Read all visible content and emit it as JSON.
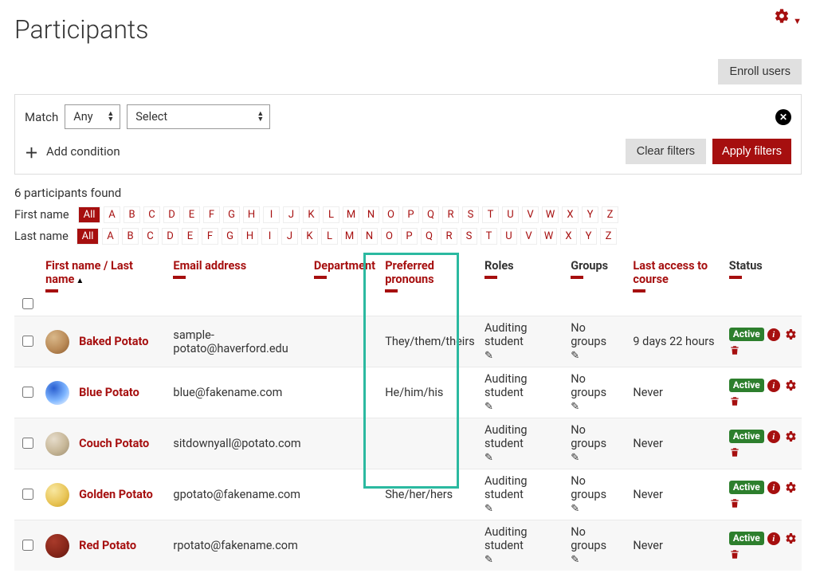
{
  "page_title": "Participants",
  "enroll_button": "Enroll users",
  "filter": {
    "match_label": "Match",
    "match_value": "Any",
    "select_value": "Select",
    "add_condition": "Add condition",
    "clear_filters": "Clear filters",
    "apply_filters": "Apply filters"
  },
  "count_text": "6 participants found",
  "initials": {
    "firstname_label": "First name",
    "lastname_label": "Last name",
    "all_label": "All",
    "letters": [
      "A",
      "B",
      "C",
      "D",
      "E",
      "F",
      "G",
      "H",
      "I",
      "J",
      "K",
      "L",
      "M",
      "N",
      "O",
      "P",
      "Q",
      "R",
      "S",
      "T",
      "U",
      "V",
      "W",
      "X",
      "Y",
      "Z"
    ]
  },
  "table": {
    "headers": {
      "name_a": "First name",
      "name_sep": " / ",
      "name_b": "Last name",
      "email": "Email address",
      "department": "Department",
      "pronouns": "Preferred pronouns",
      "roles": "Roles",
      "groups": "Groups",
      "last_access": "Last access to course",
      "status": "Status"
    },
    "rows": [
      {
        "avatar_colors": [
          "#d9b88a",
          "#ba8b58",
          "#8c5a2b"
        ],
        "name": "Baked Potato",
        "email": "sample-potato@haverford.edu",
        "department": "",
        "pronouns": "They/them/theirs",
        "role": "Auditing student",
        "groups": "No groups",
        "last_access": "9 days 22 hours",
        "status": "Active"
      },
      {
        "avatar_colors": [
          "#2a5fd0",
          "#7fb6ff",
          "#ffffff"
        ],
        "name": "Blue Potato",
        "email": "blue@fakename.com",
        "department": "",
        "pronouns": "He/him/his",
        "role": "Auditing student",
        "groups": "No groups",
        "last_access": "Never",
        "status": "Active"
      },
      {
        "avatar_colors": [
          "#e6dccb",
          "#c7b798",
          "#9c8d6f"
        ],
        "name": "Couch Potato",
        "email": "sitdownyall@potato.com",
        "department": "",
        "pronouns": "",
        "role": "Auditing student",
        "groups": "No groups",
        "last_access": "Never",
        "status": "Active"
      },
      {
        "avatar_colors": [
          "#f8e7a0",
          "#e9c65a",
          "#cda01f"
        ],
        "name": "Golden Potato",
        "email": "gpotato@fakename.com",
        "department": "",
        "pronouns": "She/her/hers",
        "role": "Auditing student",
        "groups": "No groups",
        "last_access": "Never",
        "status": "Active"
      },
      {
        "avatar_colors": [
          "#a83a2a",
          "#88271a",
          "#5e1710"
        ],
        "name": "Red Potato",
        "email": "rpotato@fakename.com",
        "department": "",
        "pronouns": "",
        "role": "Auditing student",
        "groups": "No groups",
        "last_access": "Never",
        "status": "Active"
      }
    ]
  }
}
